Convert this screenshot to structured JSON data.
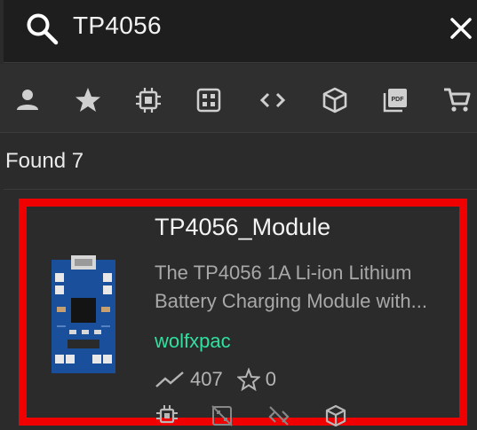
{
  "search": {
    "value": "TP4056",
    "placeholder": ""
  },
  "toolbar": {
    "items": [
      {
        "icon": "user-icon"
      },
      {
        "icon": "star-icon"
      },
      {
        "icon": "chip-icon"
      },
      {
        "icon": "footprint-icon"
      },
      {
        "icon": "code-icon"
      },
      {
        "icon": "cube-icon"
      },
      {
        "icon": "pdf-icon"
      },
      {
        "icon": "cart-icon"
      }
    ]
  },
  "results": {
    "found_text": "Found 7"
  },
  "card": {
    "title": "TP4056_Module",
    "description_line1": "The TP4056 1A Li-ion Lithium",
    "description_line2": "Battery Charging Module with...",
    "author": "wolfxpac",
    "views": "407",
    "stars": "0",
    "border_color": "#f00000",
    "author_color": "#2fe0a0"
  }
}
